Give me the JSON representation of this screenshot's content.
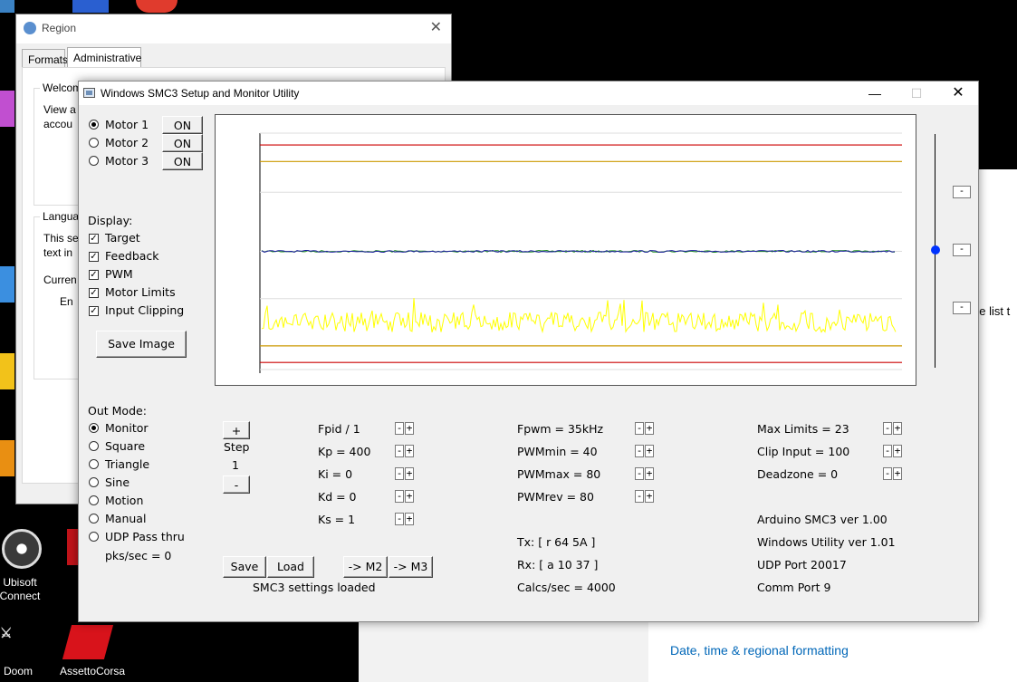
{
  "desktop": {
    "icons": [
      {
        "label": "Ubisoft Connect"
      },
      {
        "label": "Doom"
      },
      {
        "label": "AssettoCorsa"
      }
    ]
  },
  "background_settings": {
    "link_text": "Date, time & regional formatting",
    "partial_text": "he list t"
  },
  "region_dialog": {
    "title": "Region",
    "tabs": [
      "Formats",
      "Administrative"
    ],
    "active_tab": "Administrative",
    "welcome_title": "Welcom",
    "welcome_line1": "View a",
    "welcome_line2": "accou",
    "language_title": "Langua",
    "lang_line1": "This se",
    "lang_line2": "text in",
    "current": "Curren",
    "en": "En"
  },
  "smc": {
    "title": "Windows SMC3 Setup and Monitor Utility",
    "motors": [
      {
        "label": "Motor 1",
        "button": "ON",
        "selected": true
      },
      {
        "label": "Motor 2",
        "button": "ON",
        "selected": false
      },
      {
        "label": "Motor 3",
        "button": "ON",
        "selected": false
      }
    ],
    "display_title": "Display:",
    "display_options": [
      {
        "label": "Target",
        "checked": true
      },
      {
        "label": "Feedback",
        "checked": true
      },
      {
        "label": "PWM",
        "checked": true
      },
      {
        "label": "Motor Limits",
        "checked": true
      },
      {
        "label": "Input Clipping",
        "checked": true
      }
    ],
    "save_image": "Save Image",
    "out_mode_title": "Out Mode:",
    "out_modes": [
      {
        "label": "Monitor",
        "selected": true
      },
      {
        "label": "Square",
        "selected": false
      },
      {
        "label": "Triangle",
        "selected": false
      },
      {
        "label": "Sine",
        "selected": false
      },
      {
        "label": "Motion",
        "selected": false
      },
      {
        "label": "Manual",
        "selected": false
      },
      {
        "label": "UDP Pass thru",
        "selected": false
      }
    ],
    "pks_sec": "pks/sec = 0",
    "step": {
      "plus": "+",
      "label": "Step",
      "value": "1",
      "minus": "-"
    },
    "pid": [
      "Fpid / 1",
      "Kp = 400",
      "Ki = 0",
      "Kd = 0",
      "Ks = 1"
    ],
    "pwm": [
      "Fpwm = 35kHz",
      "PWMmin = 40",
      "PWMmax = 80",
      "PWMrev = 80"
    ],
    "limits": [
      "Max Limits = 23",
      "Clip Input = 100",
      "Deadzone = 0"
    ],
    "info": [
      "Arduino SMC3 ver 1.00",
      "Windows Utility ver 1.01",
      "UDP Port 20017",
      "Comm Port 9"
    ],
    "tx": "Tx: [ r 64 5A ]",
    "rx": "Rx: [ a 10 37 ]",
    "calcs": "Calcs/sec = 4000",
    "buttons": {
      "save": "Save",
      "load": "Load",
      "m2": "-> M2",
      "m3": "-> M3"
    },
    "status": "SMC3 settings loaded",
    "pm_minus": "-",
    "pm_plus": "+",
    "side_btn": "-"
  },
  "chart_data": {
    "type": "line",
    "series": [
      {
        "color": "#cc0000",
        "level": 0.95
      },
      {
        "color": "#cc9900",
        "level": 0.88
      },
      {
        "color": "#1a8f1a",
        "level": 0.5
      },
      {
        "color": "#1a1aa0",
        "level": 0.5
      },
      {
        "color": "#ffff00",
        "level": 0.2,
        "noise": true
      },
      {
        "color": "#cc9900",
        "level": 0.1
      },
      {
        "color": "#cc0000",
        "level": 0.03
      }
    ]
  }
}
